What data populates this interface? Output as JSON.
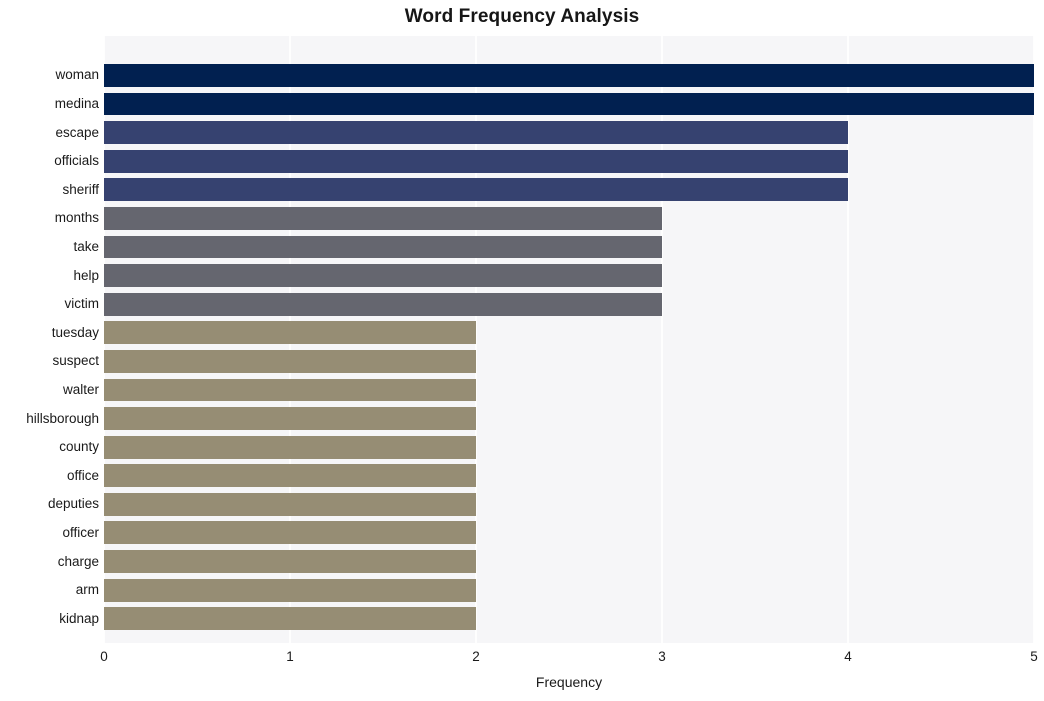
{
  "chart_data": {
    "type": "bar",
    "orientation": "horizontal",
    "title": "Word Frequency Analysis",
    "xlabel": "Frequency",
    "ylabel": "",
    "categories": [
      "woman",
      "medina",
      "escape",
      "officials",
      "sheriff",
      "months",
      "take",
      "help",
      "victim",
      "tuesday",
      "suspect",
      "walter",
      "hillsborough",
      "county",
      "office",
      "deputies",
      "officer",
      "charge",
      "arm",
      "kidnap"
    ],
    "values": [
      5,
      5,
      4,
      4,
      4,
      3,
      3,
      3,
      3,
      2,
      2,
      2,
      2,
      2,
      2,
      2,
      2,
      2,
      2,
      2
    ],
    "bar_colors": [
      "#012050",
      "#012050",
      "#364270",
      "#364270",
      "#364270",
      "#65666f",
      "#65666f",
      "#65666f",
      "#65666f",
      "#968d74",
      "#968d74",
      "#968d74",
      "#968d74",
      "#968d74",
      "#968d74",
      "#968d74",
      "#968d74",
      "#968d74",
      "#968d74",
      "#968d74"
    ],
    "xlim": [
      0,
      5.0
    ],
    "xticks": [
      0,
      1,
      2,
      3,
      4,
      5
    ],
    "xtick_labels": [
      "0",
      "1",
      "2",
      "3",
      "4",
      "5"
    ],
    "grid": true,
    "grid_axis": "x",
    "legend": false,
    "plot_background": "#f6f6f8",
    "figure_background": "#ffffff"
  }
}
